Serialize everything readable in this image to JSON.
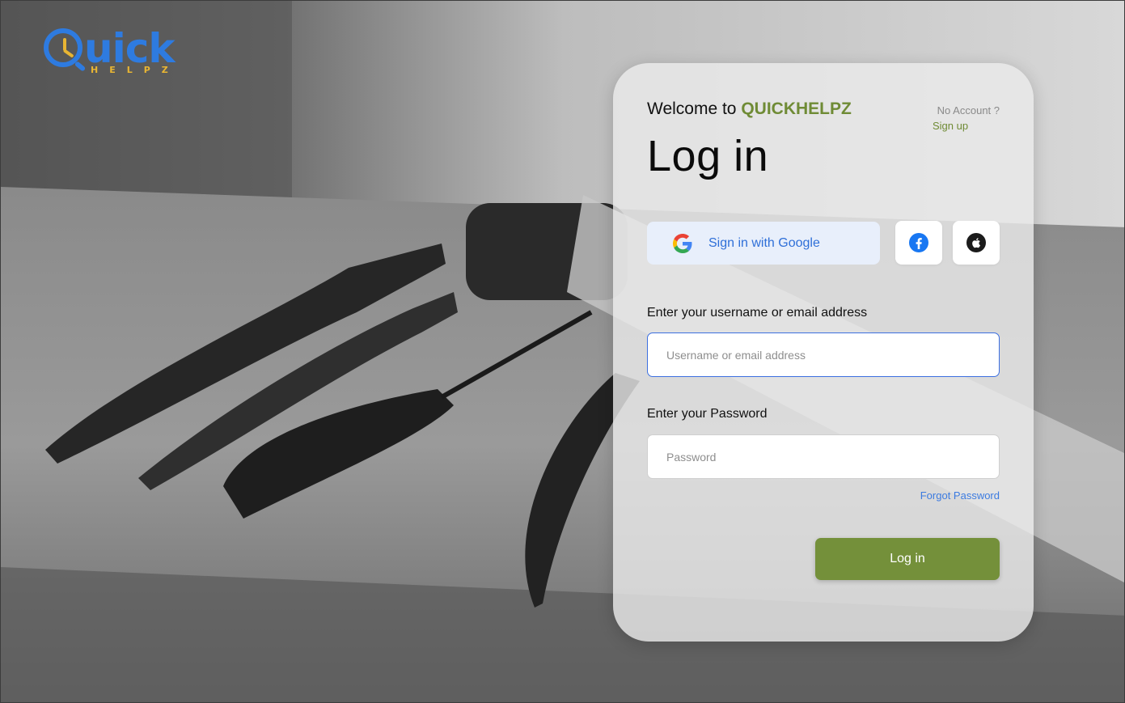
{
  "brand": {
    "logo_word": "uick",
    "logo_sub": "HELPZ",
    "accent_blue": "#2e7be0",
    "accent_gold": "#e8b533",
    "accent_green": "#74903a"
  },
  "card": {
    "welcome_prefix": "Welcome to ",
    "welcome_brand": "QUICKHELPZ",
    "no_account": "No Account ?",
    "signup_link": "Sign up",
    "title": "Log in",
    "google_label": "Sign in with Google",
    "facebook_icon": "facebook-icon",
    "apple_icon": "apple-icon",
    "username_label": "Enter your username or email address",
    "username_placeholder": "Username or email address",
    "username_value": "",
    "password_label": "Enter your Password",
    "password_placeholder": "Password",
    "password_value": "",
    "forgot_link": "Forgot Password",
    "login_button": "Log in"
  }
}
